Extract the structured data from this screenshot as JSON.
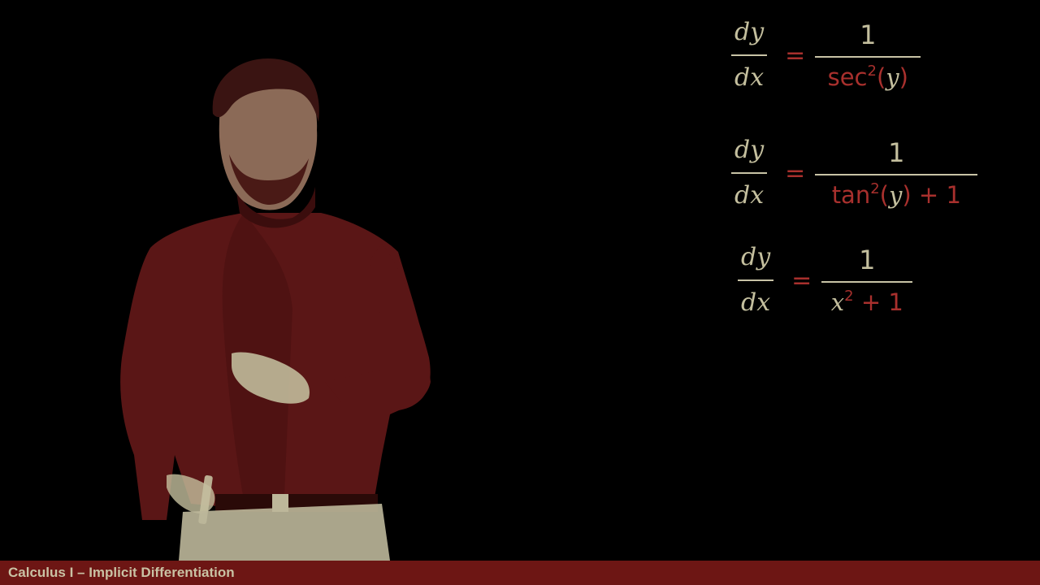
{
  "scene": {
    "description_free": true
  },
  "colors": {
    "background": "#000000",
    "cream": "#c4bf9e",
    "accent_red": "#a8302d",
    "bar_red": "#6d1614"
  },
  "equations": [
    {
      "lhs_num": "dy",
      "lhs_den": "dx",
      "equals": "=",
      "rhs_num": "1",
      "rhs_den": {
        "pre": "sec",
        "sup": "2",
        "open": "(",
        "var": "y",
        "close": ")",
        "post": ""
      }
    },
    {
      "lhs_num": "dy",
      "lhs_den": "dx",
      "equals": "=",
      "rhs_num": "1",
      "rhs_den": {
        "pre": "tan",
        "sup": "2",
        "open": "(",
        "var": "y",
        "close": ")",
        "post": " + 1"
      }
    },
    {
      "lhs_num": "dy",
      "lhs_den": "dx",
      "equals": "=",
      "rhs_num": "1",
      "rhs_den": {
        "pre": "",
        "sup": "2",
        "open": "",
        "var": "x",
        "close": "",
        "post": " + 1"
      }
    }
  ],
  "footer": {
    "title": "Calculus I – Implicit Differentiation"
  }
}
